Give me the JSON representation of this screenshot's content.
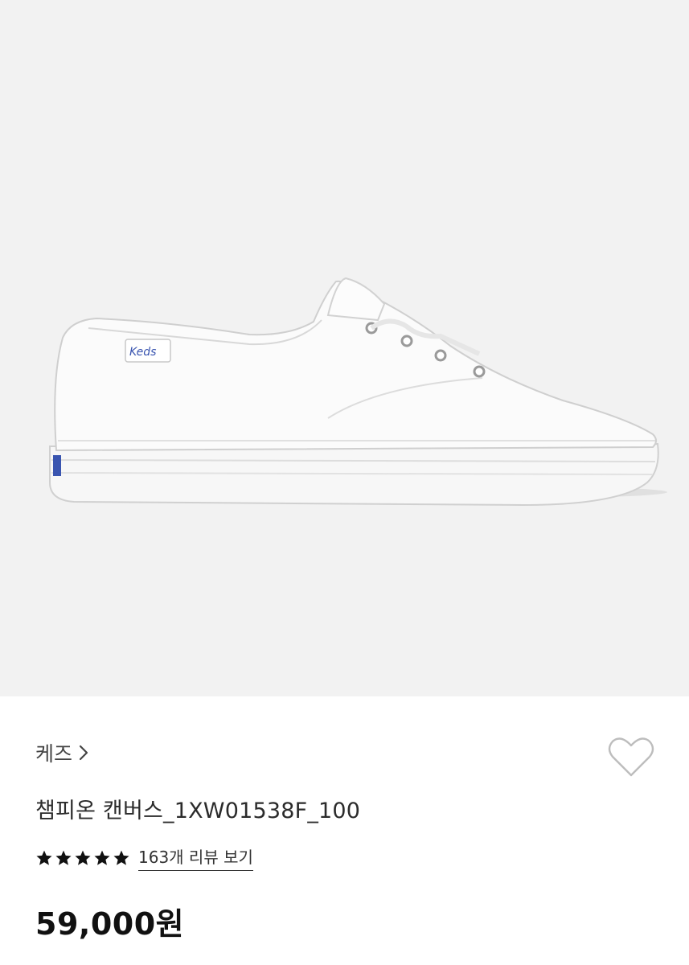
{
  "product": {
    "image": {
      "description_icon": "white-canvas-sneaker",
      "shoe_logo": "Keds"
    },
    "brand_link": "케즈",
    "title": "챔피온 캔버스_1XW01538F_100",
    "rating": {
      "stars": 5,
      "max": 5,
      "reviews_link": "163개 리뷰 보기"
    },
    "price": "59,000원",
    "wishlist_icon": "heart-outline-icon"
  },
  "colors": {
    "hero_bg": "#f2f2f2",
    "star": "#111111",
    "heart_stroke": "#bdbdbd",
    "logo_blue": "#3a55b0"
  }
}
